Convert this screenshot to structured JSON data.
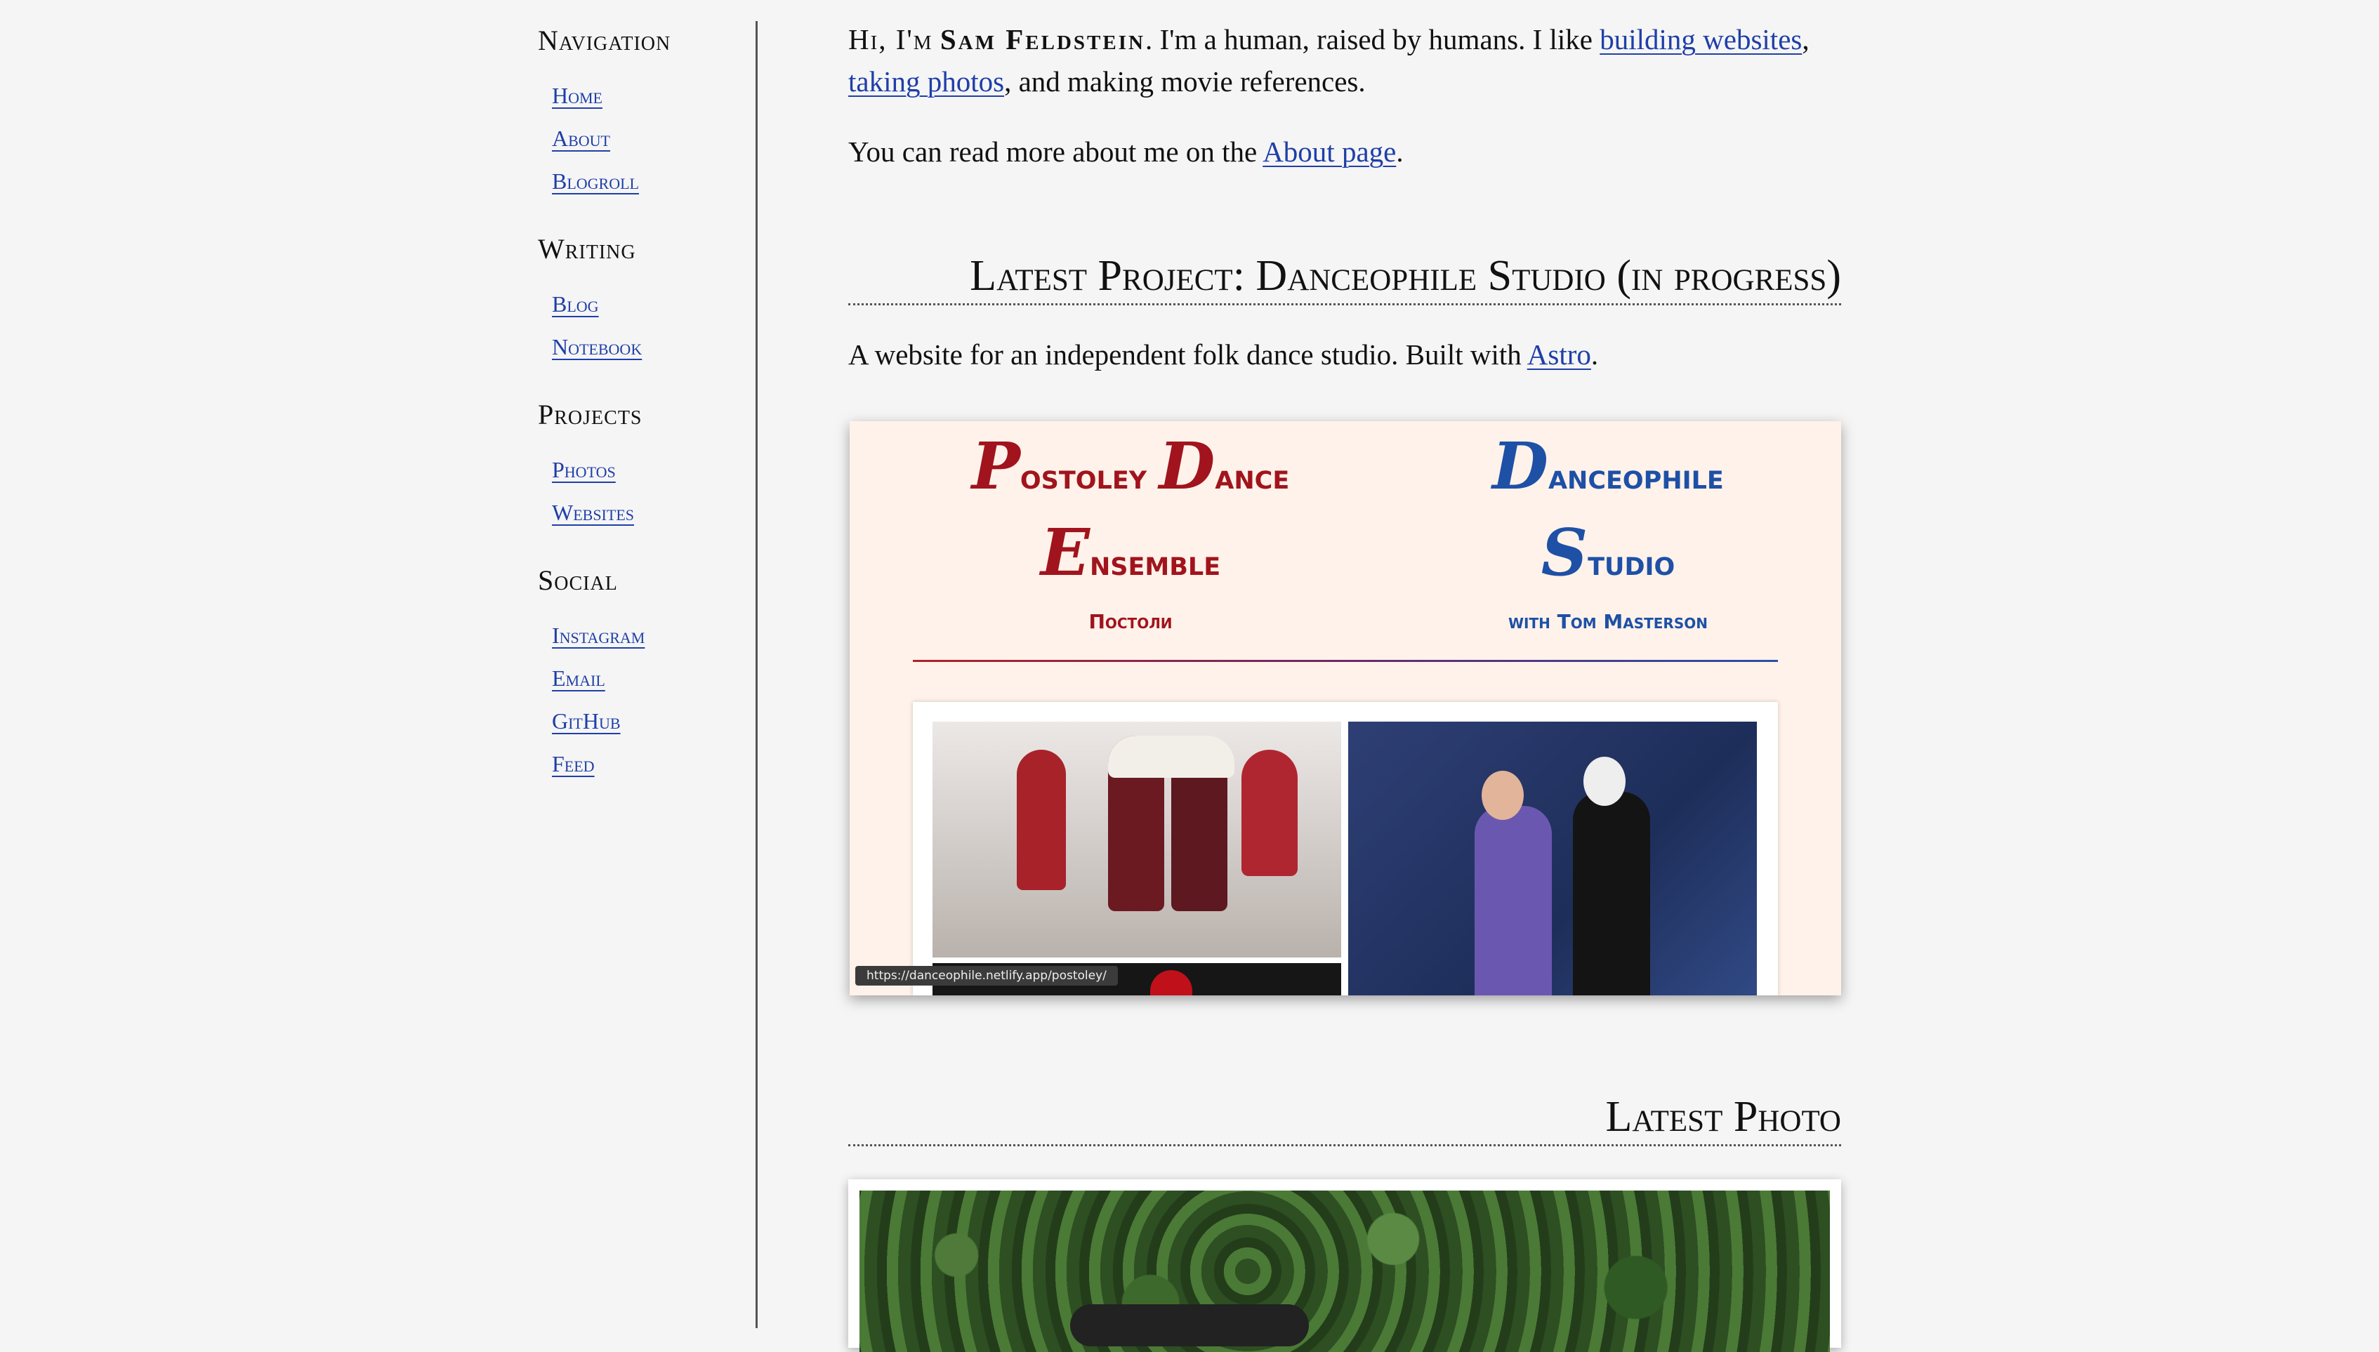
{
  "sidebar": {
    "sections": [
      {
        "heading": "Navigation",
        "items": [
          "Home",
          "About",
          "Blogroll"
        ]
      },
      {
        "heading": "Writing",
        "items": [
          "Blog",
          "Notebook"
        ]
      },
      {
        "heading": "Projects",
        "items": [
          "Photos",
          "Websites"
        ]
      },
      {
        "heading": "Social",
        "items": [
          "Instagram",
          "Email",
          "GitHub",
          "Feed"
        ]
      }
    ]
  },
  "intro": {
    "hi": "Hi, I'm",
    "name": "Sam Feldstein",
    "text_a": ". I'm a human, raised by humans. I like ",
    "link_websites": "building websites",
    "comma": ", ",
    "link_photos": "taking photos",
    "text_b": ", and making movie references.",
    "more_a": "You can read more about me on the ",
    "link_about": "About page",
    "more_b": "."
  },
  "project": {
    "title": "Latest Project: Danceophile Studio (in progress)",
    "desc_a": "A website for an independent folk dance studio. Built with ",
    "link_astro": "Astro",
    "desc_b": ".",
    "card": {
      "left_line1_cap": "P",
      "left_line1_rest": "ostoley ",
      "left_line1_cap2": "D",
      "left_line1_rest2": "ance",
      "left_line2_cap": "E",
      "left_line2_rest": "nsemble",
      "left_sub": "Постоли",
      "right_line1_cap": "D",
      "right_line1_rest": "anceophile",
      "right_line2_cap": "S",
      "right_line2_rest": "tudio",
      "right_sub": "with Tom Masterson",
      "tooltip": "https://danceophile.netlify.app/postoley/"
    }
  },
  "photo": {
    "title": "Latest Photo"
  },
  "colors": {
    "link": "#1f3fa8",
    "brand_red": "#a1141d",
    "brand_blue": "#1e50a6",
    "card_bg": "#fff2ea"
  }
}
